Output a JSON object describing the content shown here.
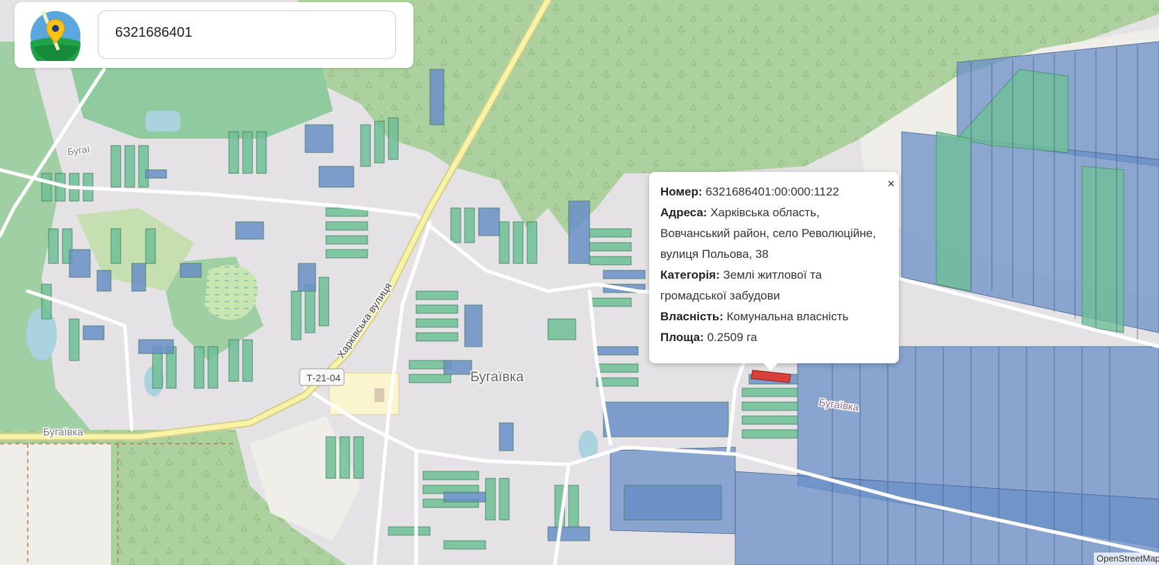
{
  "search": {
    "value": "6321686401"
  },
  "popup": {
    "close_label": "×",
    "number_label": "Номер:",
    "number_value": "6321686401:00:000:1122",
    "address_label": "Адреса:",
    "address_line1": "Харківська область,",
    "address_line2": "Вовчанський район, село Революційне,",
    "address_line3": "вулиця Польова, 38",
    "category_label": "Категорія:",
    "category_line1": "Землі житлової та",
    "category_line2": "громадської забудови",
    "ownership_label": "Власність:",
    "ownership_value": "Комунальна власність",
    "area_label": "Площа:",
    "area_value": "0.2509 га"
  },
  "map": {
    "village_label": "Бугаївка",
    "village_label_east": "Бугаївка",
    "village_label_west": "Бугаївка",
    "village_label_nw": "Бугаї",
    "street_label": "Харківська вулиця",
    "road_badge": "Т-21-04",
    "colors": {
      "land": "#e4e2e5",
      "forest": "#add19e",
      "residential_parcel": "#6fbf96",
      "agri_parcel": "#6a8fc7",
      "selected_parcel": "#d9403a",
      "road_main": "#f7f3a8",
      "road_minor": "#ffffff"
    }
  },
  "attribution": {
    "text": "OpenStreetMap"
  }
}
